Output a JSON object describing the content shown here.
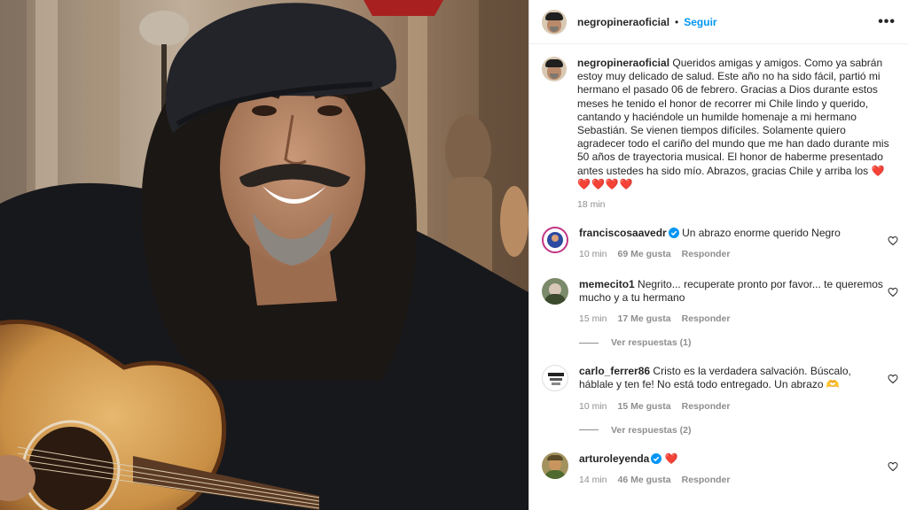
{
  "post": {
    "username": "negropineraoficial",
    "dot": "•",
    "follow_label": "Seguir",
    "more_label": "•••",
    "caption_text": "Queridos amigas y amigos. Como ya sabrán estoy muy delicado de salud. Este año no ha sido fácil, partió mi hermano el pasado 06 de febrero. Gracias a Dios durante estos meses he tenido el honor de recorrer mi Chile lindo y querido, cantando y haciéndole un humilde homenaje a mi hermano Sebastián. Se vienen tiempos difíciles. Solamente quiero agradecer todo el cariño del mundo que me han dado durante mis 50 años de trayectoria musical. El honor de haberme presentado antes ustedes ha sido mío. Abrazos, gracias Chile y arriba los",
    "caption_hearts": "❤️❤️❤️❤️❤️",
    "caption_time": "18 min"
  },
  "comments": [
    {
      "username": "franciscosaavedr",
      "verified": true,
      "text": "Un abrazo enorme querido Negro",
      "time": "10 min",
      "likes": "69 Me gusta",
      "reply_label": "Responder"
    },
    {
      "username": "memecito1",
      "verified": false,
      "text": "Negrito... recuperate pronto por favor... te queremos mucho y a tu hermano",
      "time": "15 min",
      "likes": "17 Me gusta",
      "reply_label": "Responder",
      "view_replies": "Ver respuestas (1)"
    },
    {
      "username": "carlo_ferrer86",
      "verified": false,
      "text": "Cristo es la verdadera salvación. Búscalo, háblale y ten fe! No está todo entregado. Un abrazo 🫶",
      "time": "10 min",
      "likes": "15 Me gusta",
      "reply_label": "Responder",
      "view_replies": "Ver respuestas (2)"
    },
    {
      "username": "arturoleyenda",
      "verified": true,
      "text": "❤️",
      "time": "14 min",
      "likes": "46 Me gusta",
      "reply_label": "Responder"
    }
  ],
  "icons": {
    "more": "more-options-icon",
    "like": "heart-outline-icon",
    "verified": "verified-badge-icon"
  },
  "colors": {
    "link": "#0095f6",
    "verified": "#0095f6",
    "heart": "#e0245e",
    "meta": "#8e8e8e"
  }
}
